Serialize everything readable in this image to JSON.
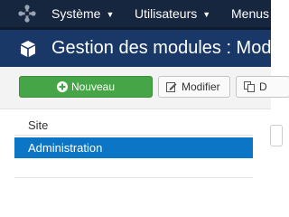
{
  "navbar": {
    "logo_icon": "joomla-logo-icon",
    "menus": [
      {
        "label": "Système"
      },
      {
        "label": "Utilisateurs"
      },
      {
        "label": "Menus"
      }
    ]
  },
  "header": {
    "icon": "cube-icon",
    "title": "Gestion des modules : Mod"
  },
  "toolbar": {
    "new_label": "Nouveau",
    "new_icon": "plus-circle-icon",
    "edit_label": "Modifier",
    "edit_icon": "pencil-icon",
    "duplicate_label": "D",
    "duplicate_icon": "copy-icon"
  },
  "sidebar": {
    "label": "Site",
    "items": [
      {
        "label": "Administration",
        "active": true
      }
    ]
  },
  "colors": {
    "navbar_bg": "#17263f",
    "title_bar_bg": "#1a3867",
    "new_button_green": "#46a546",
    "active_item_blue": "#0b76c5"
  }
}
